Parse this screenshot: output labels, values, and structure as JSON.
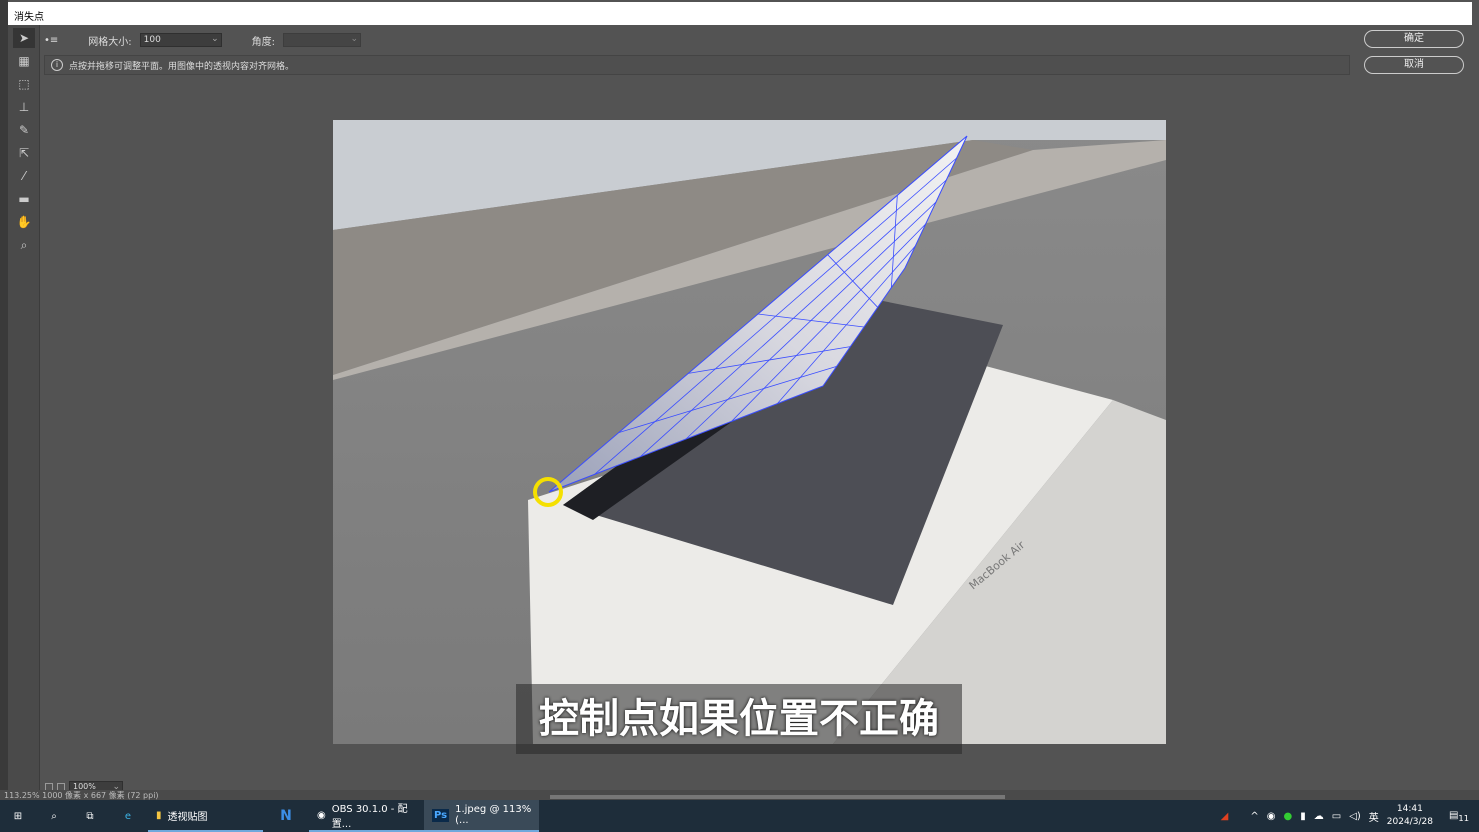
{
  "window": {
    "title": "消失点"
  },
  "options": {
    "grid_size_label": "网格大小:",
    "grid_size_value": "100",
    "angle_label": "角度:",
    "angle_value": ""
  },
  "info": {
    "message": "点按并拖移可调整平面。用图像中的透视内容对齐网格。"
  },
  "buttons": {
    "ok": "确定",
    "cancel": "取消"
  },
  "canvas": {
    "subtitle": "控制点如果位置不正确",
    "box_text": "MacBook Air"
  },
  "bottom": {
    "zoom": "100%",
    "status": "113.25% 1000 像素 x 667 像素 (72 ppi)"
  },
  "taskbar": {
    "apps": [
      {
        "label": "透视贴图",
        "icon": "folder-icon"
      },
      {
        "label": "",
        "icon": "n-app-icon"
      },
      {
        "label": "OBS 30.1.0 - 配置...",
        "icon": "obs-icon"
      },
      {
        "label": "1.jpeg @ 113% (...",
        "icon": "photoshop-icon"
      }
    ],
    "tray": {
      "ime": "英",
      "time": "14:41",
      "date": "2024/3/28",
      "notifications": "11"
    }
  },
  "colors": {
    "accent": "#6fa8dc",
    "grid": "#3a4dff",
    "cursor_highlight": "#f5e000"
  }
}
